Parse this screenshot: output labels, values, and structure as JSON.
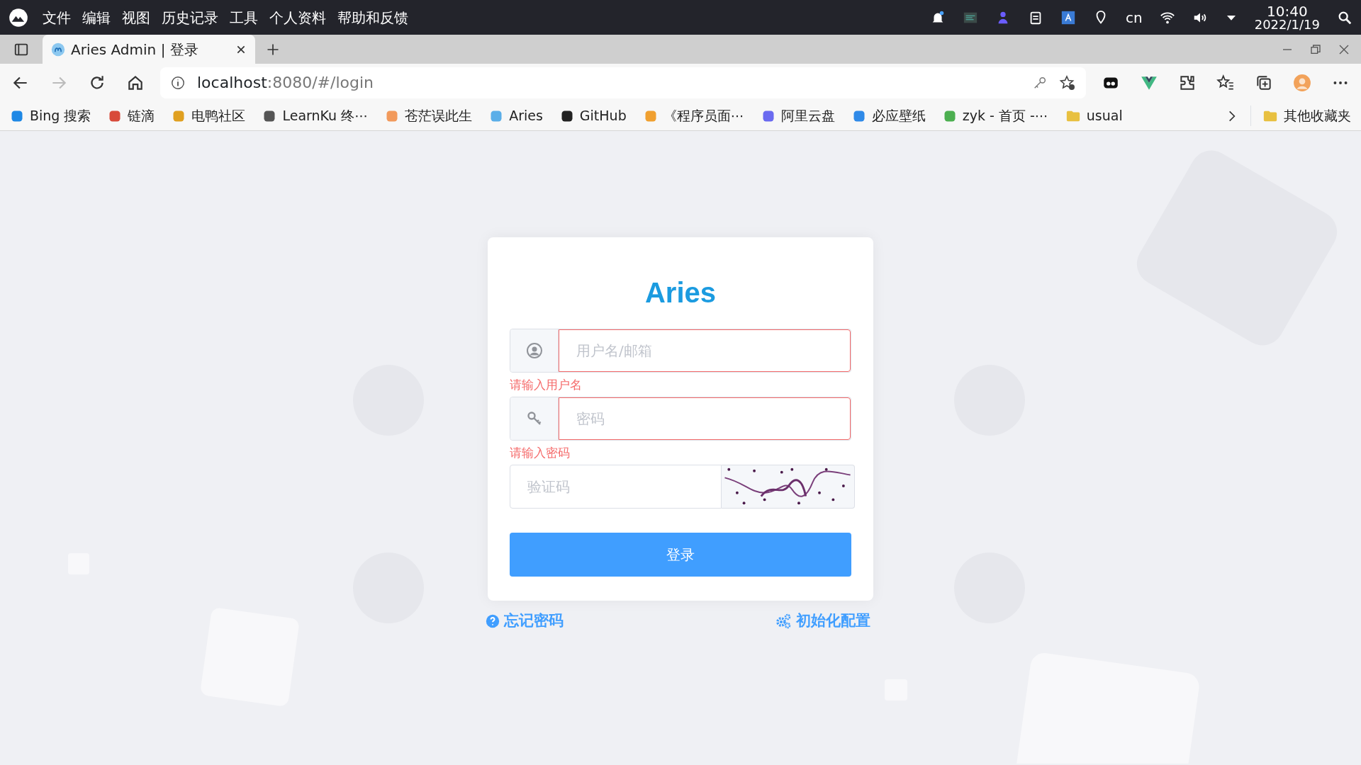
{
  "os_bar": {
    "menu": [
      "文件",
      "编辑",
      "视图",
      "历史记录",
      "工具",
      "个人资料",
      "帮助和反馈"
    ],
    "tray_text": "cn",
    "time": "10:40",
    "date": "2022/1/19"
  },
  "browser": {
    "tab": {
      "title": "Aries Admin | 登录",
      "selected": true
    },
    "address": {
      "host": "localhost",
      "path": ":8080/#/login"
    },
    "bookmarks": [
      {
        "label": "Bing 搜索",
        "kind": "site",
        "color": "#1e88e5"
      },
      {
        "label": "链滴",
        "kind": "site",
        "color": "#d84a3a"
      },
      {
        "label": "电鸭社区",
        "kind": "site",
        "color": "#e0a020"
      },
      {
        "label": "LearnKu 终⋯",
        "kind": "site",
        "color": "#555555"
      },
      {
        "label": "苍茫误此生",
        "kind": "site",
        "color": "#f29a5c"
      },
      {
        "label": "Aries",
        "kind": "site",
        "color": "#5aaee8"
      },
      {
        "label": "GitHub",
        "kind": "site",
        "color": "#222222"
      },
      {
        "label": "《程序员面⋯",
        "kind": "site",
        "color": "#f0a030"
      },
      {
        "label": "阿里云盘",
        "kind": "site",
        "color": "#6a6af0"
      },
      {
        "label": "必应壁纸",
        "kind": "site",
        "color": "#2f8ae8"
      },
      {
        "label": "zyk - 首页 -⋯",
        "kind": "site",
        "color": "#4caf50"
      },
      {
        "label": "usual",
        "kind": "folder",
        "color": "#e8c040"
      }
    ],
    "other_bookmarks": "其他收藏夹"
  },
  "login": {
    "title": "Aries",
    "fields": [
      {
        "kind": "user",
        "placeholder": "用户名/邮箱",
        "invalid": true,
        "error": "请输入用户名"
      },
      {
        "kind": "password",
        "placeholder": "密码",
        "invalid": true,
        "error": "请输入密码"
      }
    ],
    "captcha": {
      "placeholder": "验证码"
    },
    "submit": "登录",
    "links": [
      {
        "kind": "help",
        "label": "忘记密码"
      },
      {
        "kind": "settings",
        "label": "初始化配置"
      }
    ]
  }
}
